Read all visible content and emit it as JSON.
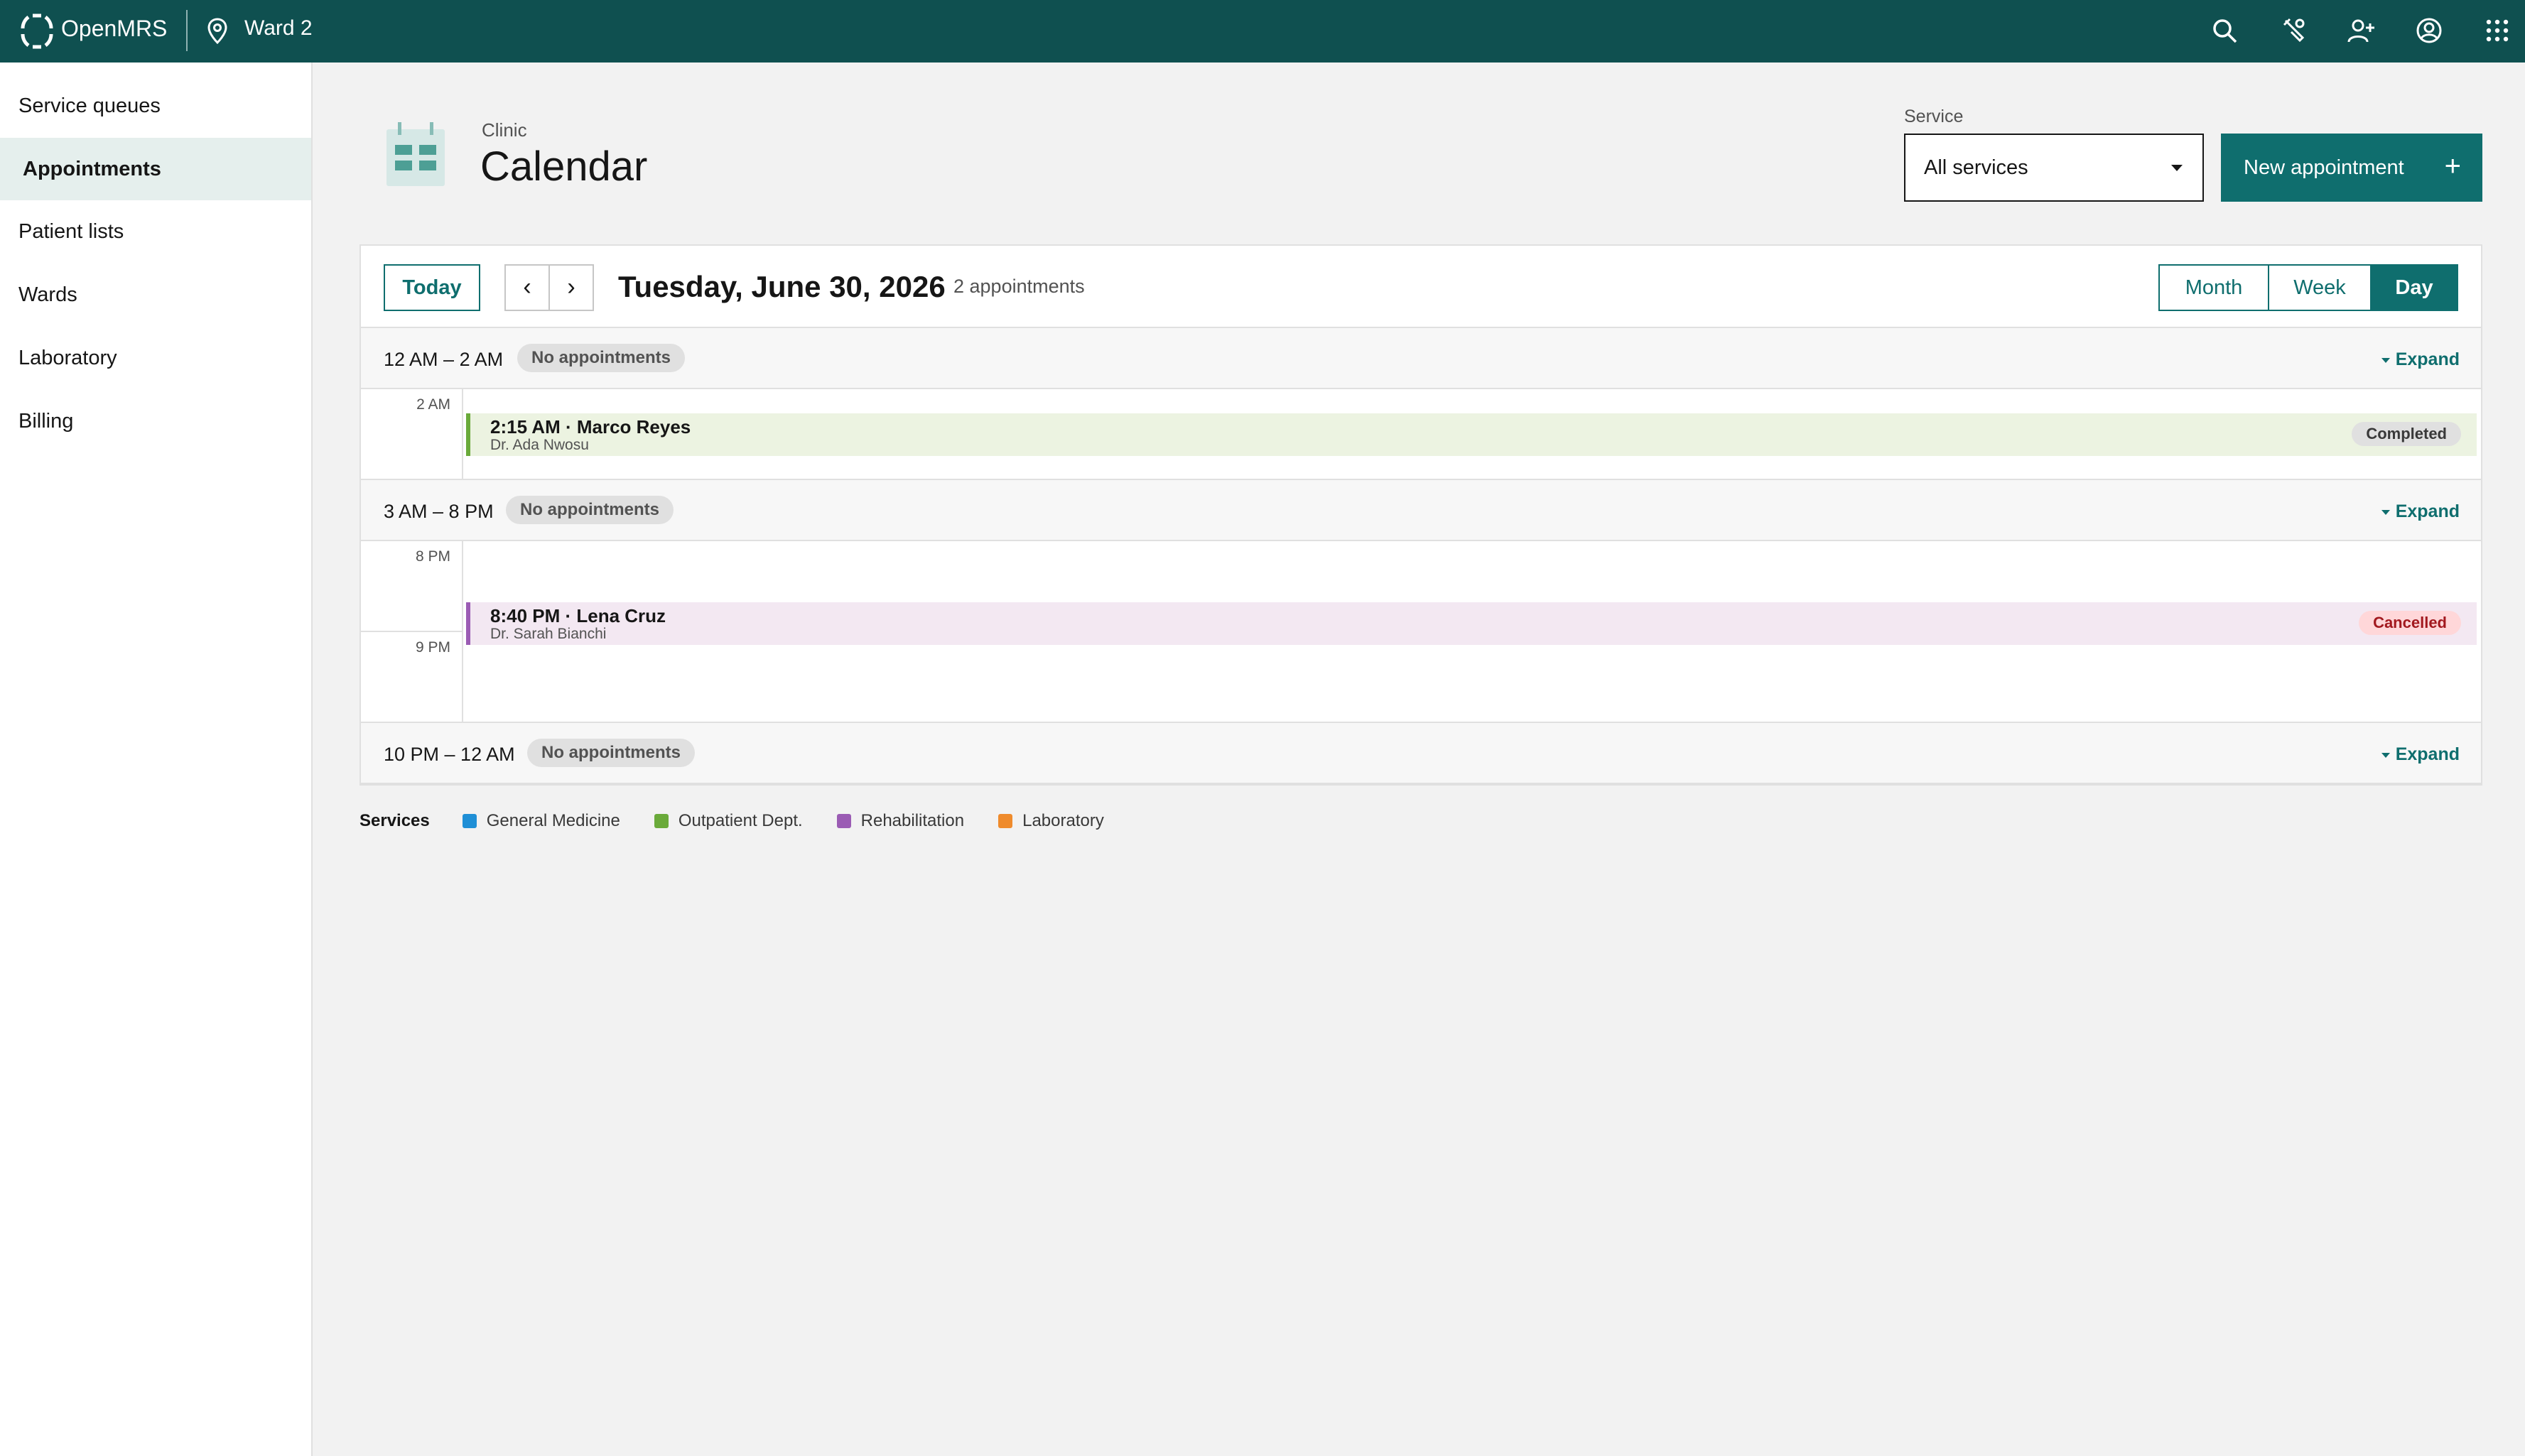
{
  "topbar": {
    "app_name": "OpenMRS",
    "location": "Ward 2",
    "icons": [
      "search-icon",
      "tools-icon",
      "add-patient-icon",
      "user-icon",
      "app-switcher-icon"
    ]
  },
  "sidebar": {
    "items": [
      {
        "label": "Service queues"
      },
      {
        "label": "Appointments",
        "active": true
      },
      {
        "label": "Patient lists"
      },
      {
        "label": "Wards"
      },
      {
        "label": "Laboratory"
      },
      {
        "label": "Billing"
      }
    ]
  },
  "header": {
    "subtitle": "Clinic",
    "title": "Calendar",
    "service_label": "Service",
    "service_value": "All services",
    "new_button": "New appointment",
    "new_button_icon": "+"
  },
  "calendar": {
    "today_label": "Today",
    "prev_icon": "‹",
    "next_icon": "›",
    "date": "Tuesday, June 30, 2026",
    "count": "2 appointments",
    "views": [
      "Month",
      "Week",
      "Day"
    ],
    "active_view": "Day",
    "no_appts": "No appointments",
    "expand": "Expand",
    "gaps": [
      "12 AM – 2 AM",
      "3 AM – 8 PM",
      "10 PM – 12 AM"
    ],
    "hours": [
      "2 AM",
      "8 PM",
      "9 PM"
    ],
    "appointments": [
      {
        "time_name": "2:15 AM · Marco Reyes",
        "doctor": "Dr. Ada Nwosu",
        "status": "Completed",
        "color": "#6aaa3a",
        "bg": "#ecf3e1",
        "status_bg": "#e0e0e0",
        "status_color": "#393939"
      },
      {
        "time_name": "8:40 PM · Lena Cruz",
        "doctor": "Dr. Sarah Bianchi",
        "status": "Cancelled",
        "color": "#9b5cb4",
        "bg": "#f3e8f2",
        "status_bg": "#ffd7d9",
        "status_color": "#a2191f"
      }
    ]
  },
  "legend": {
    "title": "Services",
    "items": [
      {
        "label": "General Medicine",
        "color": "#1f8fd6"
      },
      {
        "label": "Outpatient Dept.",
        "color": "#6aaa3a"
      },
      {
        "label": "Rehabilitation",
        "color": "#9b5cb4"
      },
      {
        "label": "Laboratory",
        "color": "#ef8b2c"
      }
    ]
  }
}
